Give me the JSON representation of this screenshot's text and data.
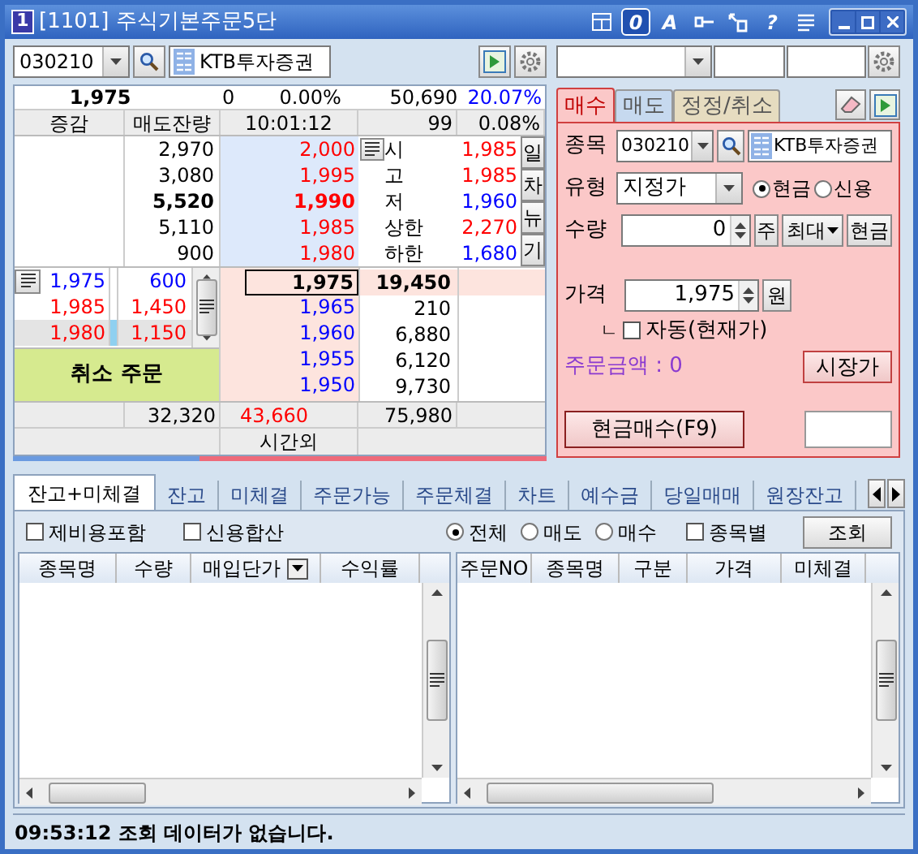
{
  "window": {
    "icon_label": "1",
    "title": "[1101] 주식기본주문5단",
    "toolbar": [
      {
        "kind": "layout"
      },
      {
        "kind": "text",
        "label": "0",
        "selected": true
      },
      {
        "kind": "text",
        "label": "A",
        "selected": false
      },
      {
        "kind": "link"
      },
      {
        "kind": "pin"
      },
      {
        "kind": "text",
        "label": "?",
        "selected": false
      },
      {
        "kind": "list"
      }
    ]
  },
  "symbol_bar": {
    "code": "030210",
    "name": "KTB투자증권"
  },
  "quote": {
    "price": "1,975",
    "change": "0",
    "change_rate": "0.00%",
    "volume": "50,690",
    "volume_rate": "20.07%"
  },
  "book_header": [
    "증감",
    "매도잔량",
    "10:01:12",
    "99",
    "0.08%"
  ],
  "asks": [
    {
      "qty": "2,970",
      "price": "2,000",
      "highlight": false
    },
    {
      "qty": "3,080",
      "price": "1,995",
      "highlight": false
    },
    {
      "qty": "5,520",
      "price": "1,990",
      "highlight": true
    },
    {
      "qty": "5,110",
      "price": "1,985",
      "highlight": false
    },
    {
      "qty": "900",
      "price": "1,980",
      "highlight": false
    }
  ],
  "info": [
    {
      "label": "시",
      "value": "1,985",
      "color": "#ff0000"
    },
    {
      "label": "고",
      "value": "1,985",
      "color": "#ff0000"
    },
    {
      "label": "저",
      "value": "1,960",
      "color": "#0000ff"
    },
    {
      "label": "상한",
      "value": "2,270",
      "color": "#ff0000"
    },
    {
      "label": "하한",
      "value": "1,680",
      "color": "#0000ff"
    }
  ],
  "side_buttons": [
    "일",
    "차",
    "뉴",
    "기"
  ],
  "my_orders": [
    {
      "price": "1,975",
      "qty": "600",
      "color": "#0000ff",
      "selected": false
    },
    {
      "price": "1,985",
      "qty": "1,450",
      "color": "#ff0000",
      "selected": false
    },
    {
      "price": "1,980",
      "qty": "1,150",
      "color": "#ff0000",
      "selected": true
    }
  ],
  "cancel_button": "취소 주문",
  "bids": [
    {
      "price": "1,975",
      "qty": "19,450",
      "current": true
    },
    {
      "price": "1,965",
      "qty": "210",
      "current": false
    },
    {
      "price": "1,960",
      "qty": "6,880",
      "current": false
    },
    {
      "price": "1,955",
      "qty": "6,120",
      "current": false
    },
    {
      "price": "1,950",
      "qty": "9,730",
      "current": false
    }
  ],
  "totals": {
    "ask_total": "32,320",
    "difference": "43,660",
    "bid_total": "75,980"
  },
  "after_hours": "시간외",
  "strength": {
    "level": 0.35
  },
  "order_form": {
    "tabs": [
      {
        "label": "매수",
        "selected": true,
        "color": "#fbc8c8"
      },
      {
        "label": "매도",
        "selected": false,
        "color": "#c6d9ef"
      },
      {
        "label": "정정/취소",
        "selected": false,
        "color": "#e6dcc0"
      }
    ],
    "symbol_label": "종목",
    "code": "030210",
    "name": "KTB투자증권",
    "type_label": "유형",
    "type": "지정가",
    "payment": [
      {
        "label": "현금",
        "selected": true
      },
      {
        "label": "신용",
        "selected": false
      }
    ],
    "qty_label": "수량",
    "qty": "0",
    "unit_button": "주",
    "max_button": "최대",
    "cash_button": "현금",
    "price_label": "가격",
    "price": "1,975",
    "won_button": "원",
    "auto": {
      "prefix": "ㄴ",
      "label": "자동(현재가)",
      "checked": false
    },
    "amount": "주문금액 : 0",
    "market_button": "시장가",
    "submit": "현금매수(F9)"
  },
  "bottom_tabs": [
    {
      "label": "잔고+미체결",
      "selected": true
    },
    {
      "label": "잔고",
      "selected": false
    },
    {
      "label": "미체결",
      "selected": false
    },
    {
      "label": "주문가능",
      "selected": false
    },
    {
      "label": "주문체결",
      "selected": false
    },
    {
      "label": "차트",
      "selected": false
    },
    {
      "label": "예수금",
      "selected": false
    },
    {
      "label": "당일매매",
      "selected": false
    },
    {
      "label": "원장잔고",
      "selected": false
    }
  ],
  "options": {
    "checks": [
      {
        "label": "제비용포함",
        "checked": false
      },
      {
        "label": "신용합산",
        "checked": false
      }
    ],
    "filter": [
      {
        "label": "전체",
        "selected": true
      },
      {
        "label": "매도",
        "selected": false
      },
      {
        "label": "매수",
        "selected": false
      }
    ],
    "by_symbol": {
      "label": "종목별",
      "checked": false
    },
    "query_button": "조회"
  },
  "balance_columns": [
    {
      "label": "종목명",
      "kind": "plain"
    },
    {
      "label": "수량",
      "kind": "plain"
    },
    {
      "label": "매입단가",
      "kind": "dropdown"
    },
    {
      "label": "수익률",
      "kind": "plain"
    }
  ],
  "order_columns": [
    "주문NO",
    "종목명",
    "구분",
    "가격",
    "미체결"
  ],
  "status": "09:53:12 조회 데이터가 없습니다."
}
